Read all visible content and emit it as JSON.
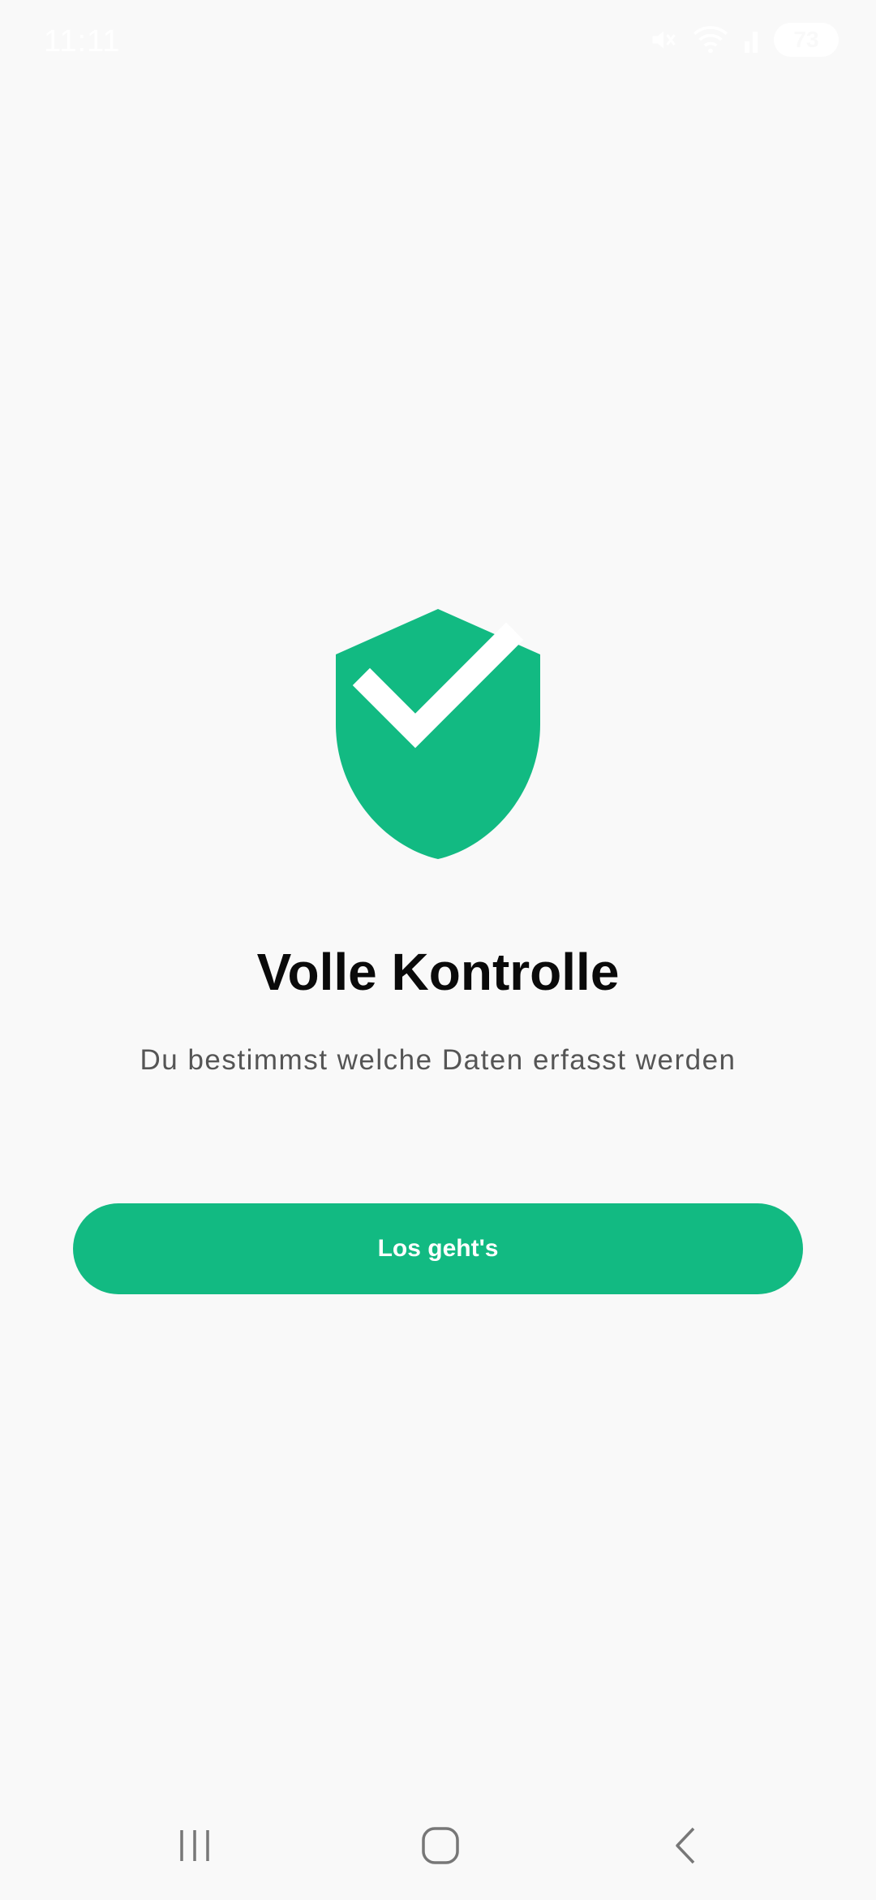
{
  "status_bar": {
    "time": "11:11",
    "battery": "73",
    "icons": [
      "mute-icon",
      "wifi-icon",
      "signal-icon",
      "battery-icon"
    ]
  },
  "onboarding": {
    "icon": "shield-check-icon",
    "title": "Volle Kontrolle",
    "subtitle": "Du bestimmst welche Daten erfasst werden",
    "cta_label": "Los geht's"
  },
  "nav_bar": {
    "icons": [
      "recents-icon",
      "home-icon",
      "back-icon"
    ]
  },
  "colors": {
    "accent": "#12ba82",
    "background": "#f9f9f9",
    "title": "#0a0a0a",
    "subtitle": "#555555"
  }
}
